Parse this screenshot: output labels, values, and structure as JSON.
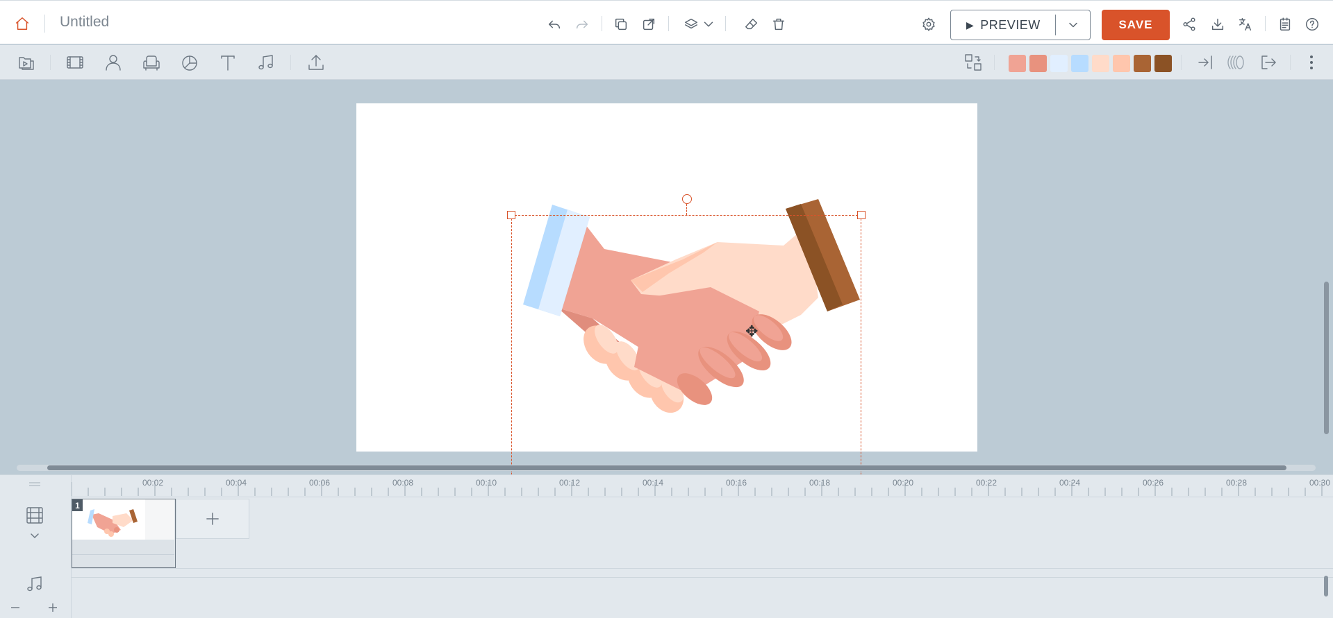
{
  "topbar": {
    "doc_title": "Untitled",
    "preview_label": "PREVIEW",
    "save_label": "SAVE",
    "icons": [
      "home-icon",
      "undo-icon",
      "redo-icon",
      "duplicate-icon",
      "external-edit-icon",
      "layers-icon",
      "chevron-down-icon",
      "eraser-icon",
      "trash-icon",
      "settings-icon",
      "share-icon",
      "download-icon",
      "translate-icon",
      "notes-icon",
      "help-icon"
    ]
  },
  "toolbar": {
    "tools": [
      "scenes-icon",
      "video-icon",
      "character-icon",
      "props-icon",
      "chart-icon",
      "text-icon",
      "music-icon",
      "upload-icon"
    ],
    "right_tools": [
      "swap-icon",
      "enter-animation-icon",
      "effect-icon",
      "exit-animation-icon",
      "more-icon"
    ],
    "palette": [
      "#f0a394",
      "#e8927e",
      "#e1efff",
      "#b7dcff",
      "#ffdbc9",
      "#ffc6ad",
      "#a96434",
      "#8b5225"
    ]
  },
  "timeline": {
    "ruler_labels": [
      "00:02",
      "00:04",
      "00:06",
      "00:08",
      "00:10",
      "00:12",
      "00:14",
      "00:16",
      "00:18",
      "00:20",
      "00:22",
      "00:24",
      "00:26",
      "00:28",
      "00:30"
    ],
    "scene_number": "1"
  },
  "colors": {
    "accent": "#d9532a",
    "stage_bg": "#bccbd5",
    "panel_bg": "#e2e8ed"
  }
}
